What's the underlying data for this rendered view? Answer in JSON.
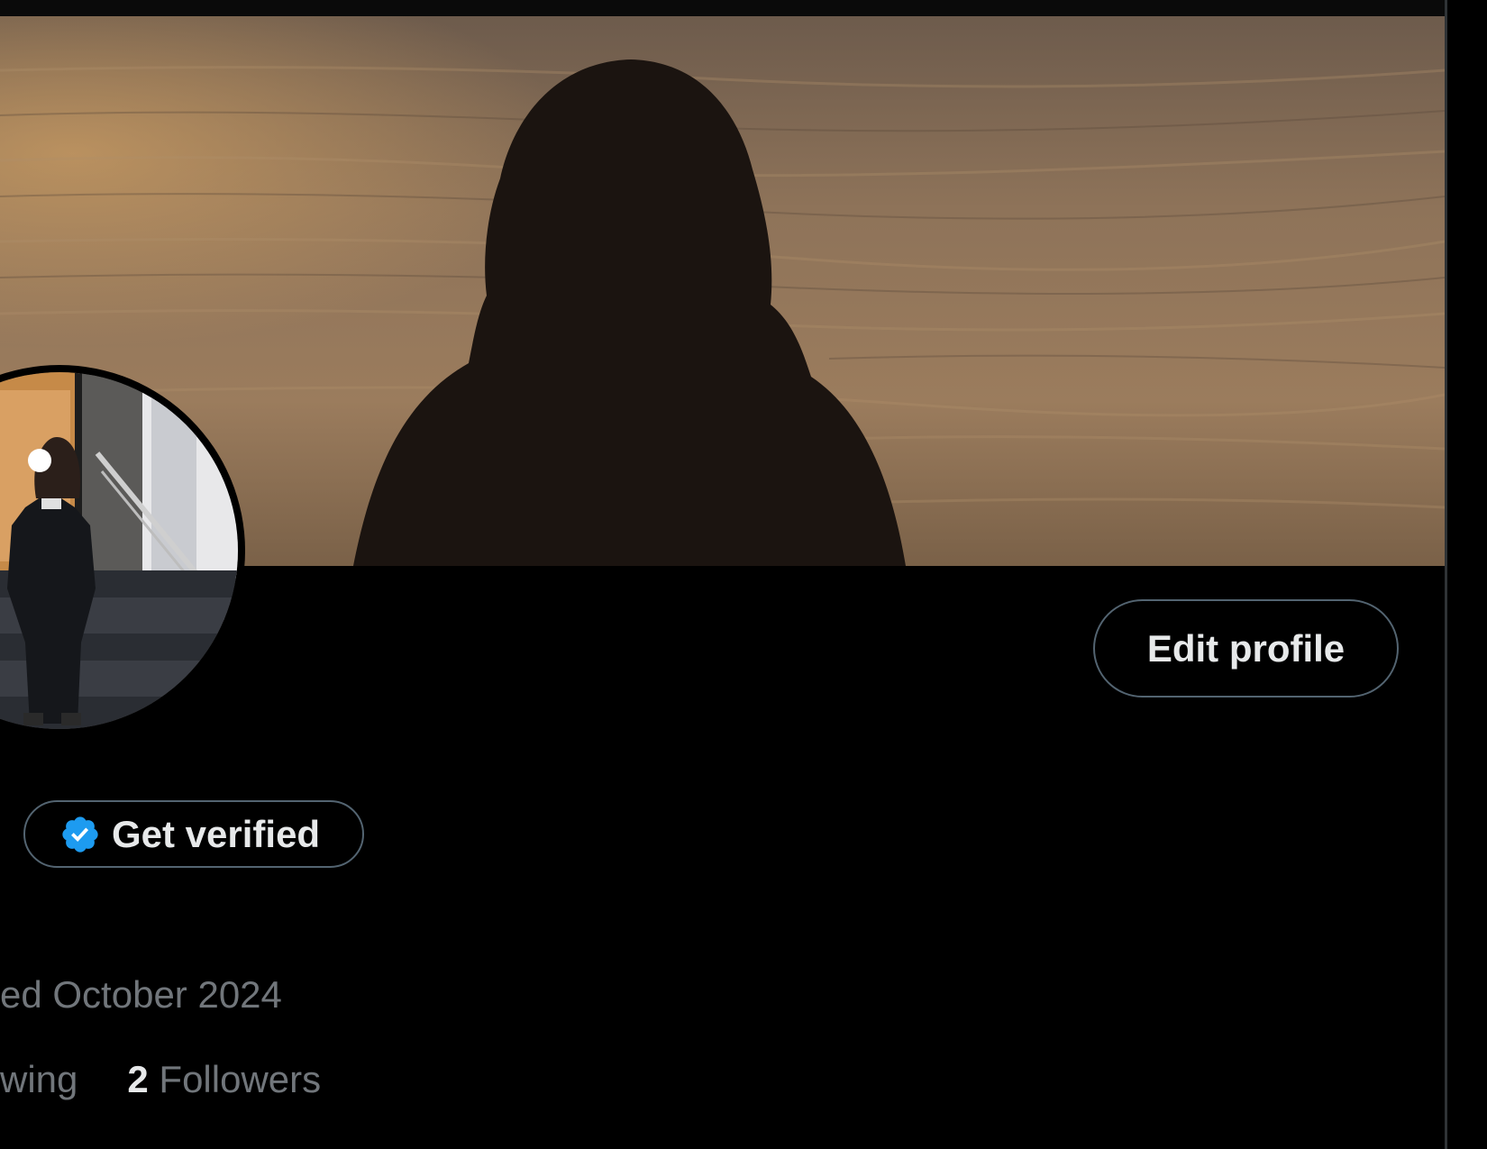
{
  "header": {
    "banner_image": "profile banner photo of a silhouetted person facing the sea at sunset",
    "edit_profile_label": "Edit profile"
  },
  "profile": {
    "avatar_image": "profile photo of a person standing in front of a stairway",
    "get_verified_label": "Get verified",
    "joined_text": "ed October 2024",
    "handle_fragment": ")",
    "following_label": "wing",
    "followers_count": "2",
    "followers_label": "Followers"
  },
  "colors": {
    "background": "#000000",
    "text_primary": "#e7e9ea",
    "text_secondary": "#71767b",
    "button_border": "#536471",
    "verified_blue": "#1d9bf0"
  },
  "icons": {
    "verified": "verified-badge-icon"
  }
}
